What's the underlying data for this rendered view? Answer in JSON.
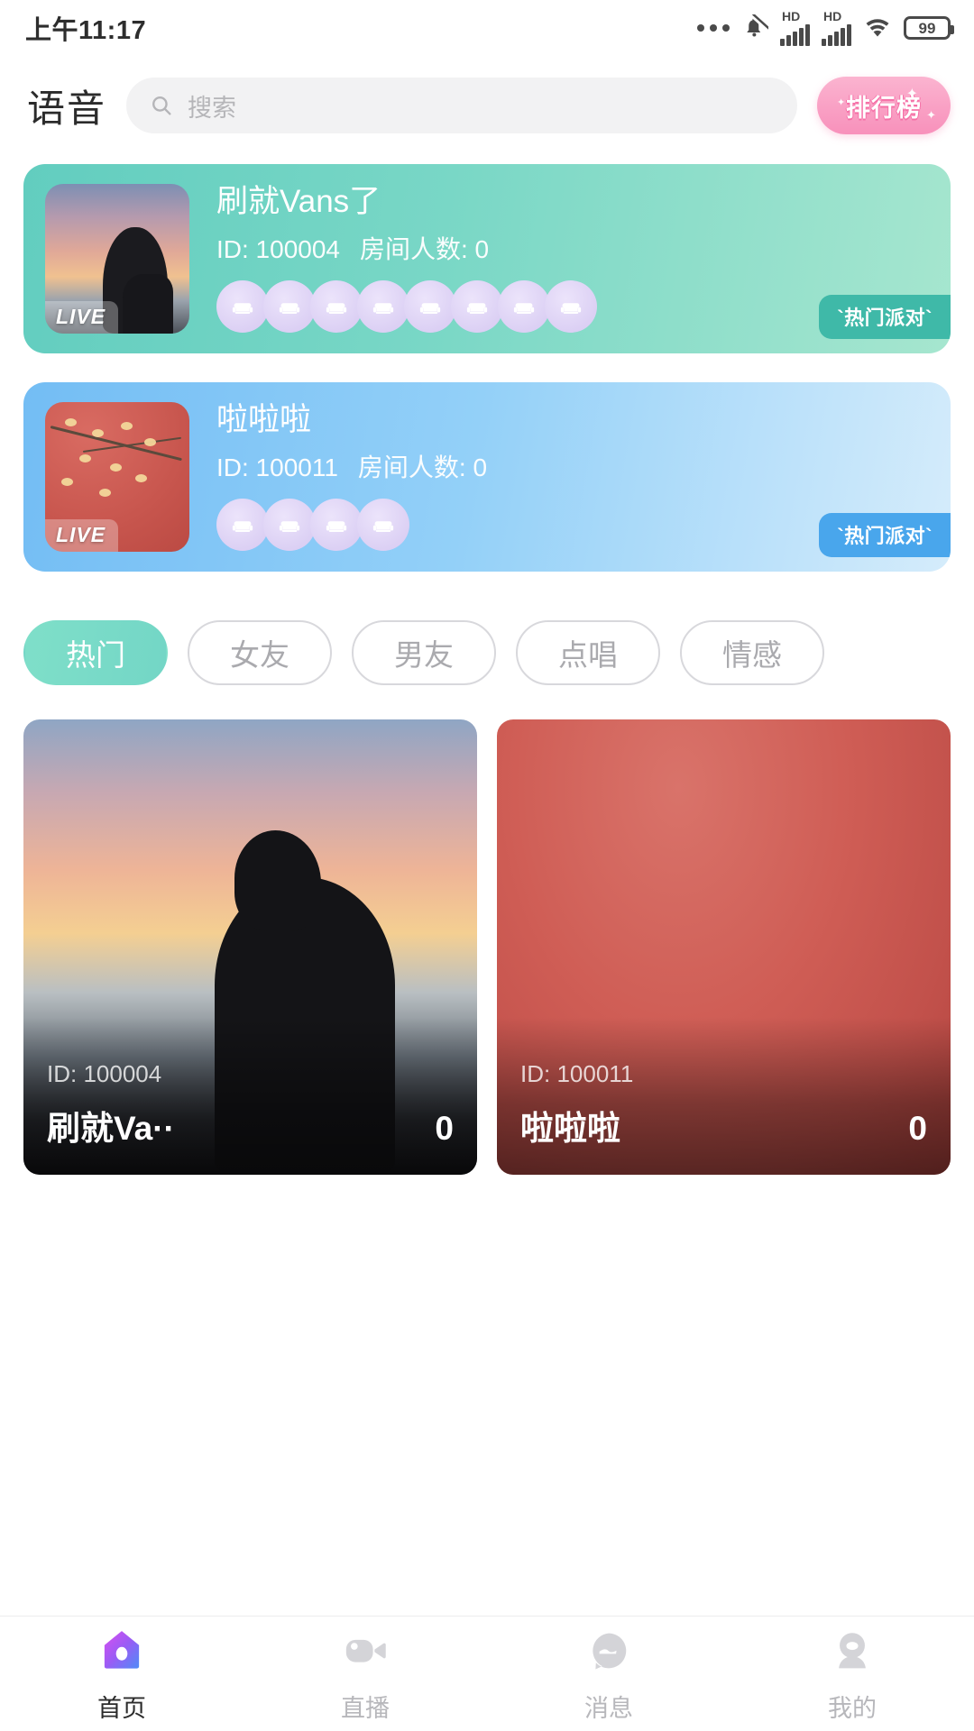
{
  "status_bar": {
    "time": "上午11:17",
    "icons": [
      "more-dots-icon",
      "bell-mute-icon",
      "hd-signal-icon",
      "hd-signal-icon",
      "wifi-icon",
      "battery-icon"
    ],
    "hd_label": "HD",
    "battery_level": "99"
  },
  "header": {
    "title": "语音",
    "search": {
      "placeholder": "搜索",
      "value": "",
      "icon": "search-icon"
    },
    "rank_button": {
      "label": "排行榜",
      "color": "#f891bb"
    }
  },
  "rooms": [
    {
      "title": "刷就Vans了",
      "id_label": "ID: 100004",
      "members_label": "房间人数: 0",
      "live_label": "LIVE",
      "badge": "`热门派对`",
      "seat_count": 8,
      "theme": "teal",
      "accent": "#3fb9a8"
    },
    {
      "title": "啦啦啦",
      "id_label": "ID: 100011",
      "members_label": "房间人数: 0",
      "live_label": "LIVE",
      "badge": "`热门派对`",
      "seat_count": 4,
      "theme": "blue",
      "accent": "#49a6ec"
    }
  ],
  "filters": {
    "active_index": 0,
    "items": [
      {
        "label": "热门"
      },
      {
        "label": "女友"
      },
      {
        "label": "男友"
      },
      {
        "label": "点唱"
      },
      {
        "label": "情感"
      }
    ],
    "active_color": "#73d6c6"
  },
  "grid": [
    {
      "id_label": "ID: 100004",
      "title": "刷就Va··",
      "count": "0"
    },
    {
      "id_label": "ID: 100011",
      "title": "啦啦啦",
      "count": "0"
    }
  ],
  "tabbar": {
    "active_index": 0,
    "items": [
      {
        "label": "首页",
        "icon": "home-icon"
      },
      {
        "label": "直播",
        "icon": "video-camera-icon"
      },
      {
        "label": "消息",
        "icon": "chat-bubble-icon"
      },
      {
        "label": "我的",
        "icon": "person-icon"
      }
    ]
  }
}
